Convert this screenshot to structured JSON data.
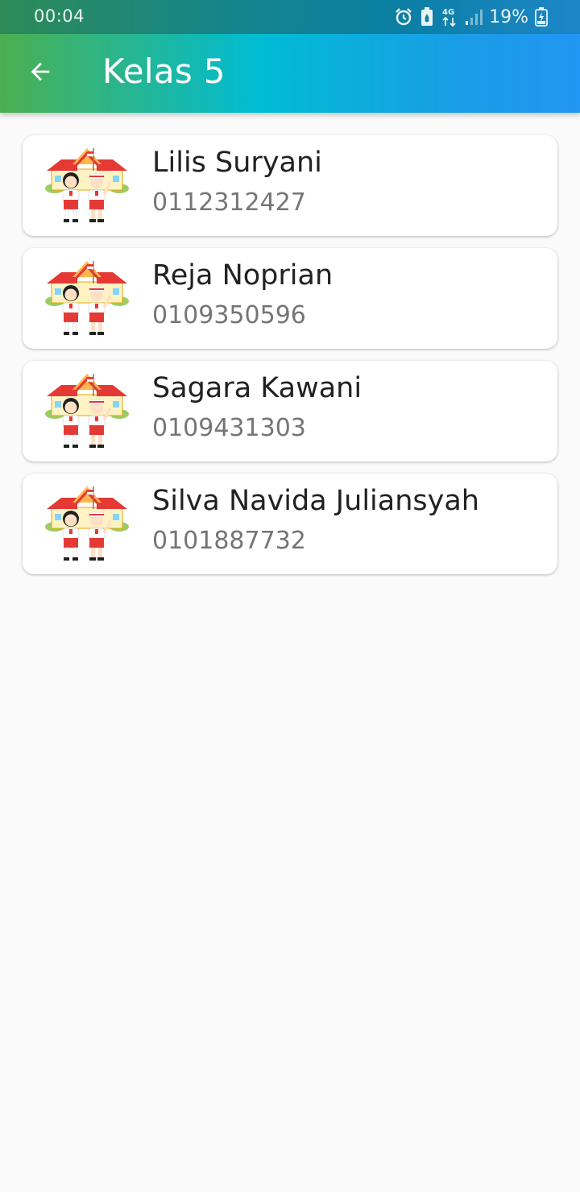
{
  "status_bar": {
    "time": "00:04",
    "network": "4G",
    "battery": "19%",
    "icons": [
      "alarm-icon",
      "battery-saver-icon",
      "network-4g-icon",
      "signal-icon",
      "battery-charging-icon"
    ]
  },
  "app_bar": {
    "title": "Kelas 5",
    "back_icon": "arrow-left-icon",
    "colors": {
      "start": "#4caf50",
      "mid": "#00bcd4",
      "end": "#2196f3"
    }
  },
  "students": [
    {
      "name": "Lilis Suryani",
      "nis": "0112312427",
      "icon": "school-children-icon"
    },
    {
      "name": "Reja Noprian",
      "nis": "0109350596",
      "icon": "school-children-icon"
    },
    {
      "name": "Sagara Kawani",
      "nis": "0109431303",
      "icon": "school-children-icon"
    },
    {
      "name": "Silva Navida Juliansyah",
      "nis": "0101887732",
      "icon": "school-children-icon"
    }
  ]
}
